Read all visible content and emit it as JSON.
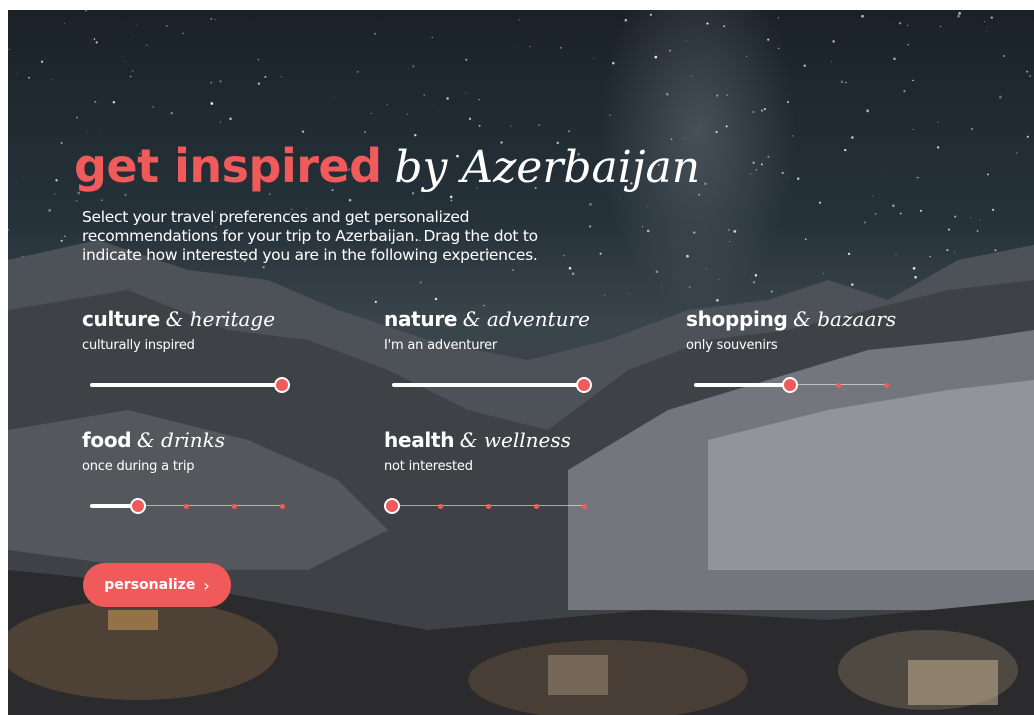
{
  "header": {
    "title_bold": "get inspired",
    "title_italic": "by Azerbaijan",
    "intro": "Select your travel preferences and get personalized recommendations for your trip to Azerbaijan. Drag the dot to indicate how interested you are in the following experiences."
  },
  "preferences": [
    {
      "bold": "culture",
      "italic": "& heritage",
      "level_label": "culturally inspired",
      "level": 1.0,
      "stops": 1
    },
    {
      "bold": "nature",
      "italic": "& adventure",
      "level_label": "I'm an adventurer",
      "level": 1.0,
      "stops": 1
    },
    {
      "bold": "shopping",
      "italic": "& bazaars",
      "level_label": "only souvenirs",
      "level": 0.5,
      "stops": 4
    },
    {
      "bold": "food",
      "italic": "& drinks",
      "level_label": "once during a trip",
      "level": 0.25,
      "stops": 4
    },
    {
      "bold": "health",
      "italic": "& wellness",
      "level_label": "not interested",
      "level": 0.0,
      "stops": 4
    }
  ],
  "actions": {
    "personalize_label": "personalize",
    "personalize_icon": "chevron-right-icon"
  },
  "colors": {
    "accent": "#f05a5b",
    "text": "#ffffff"
  }
}
